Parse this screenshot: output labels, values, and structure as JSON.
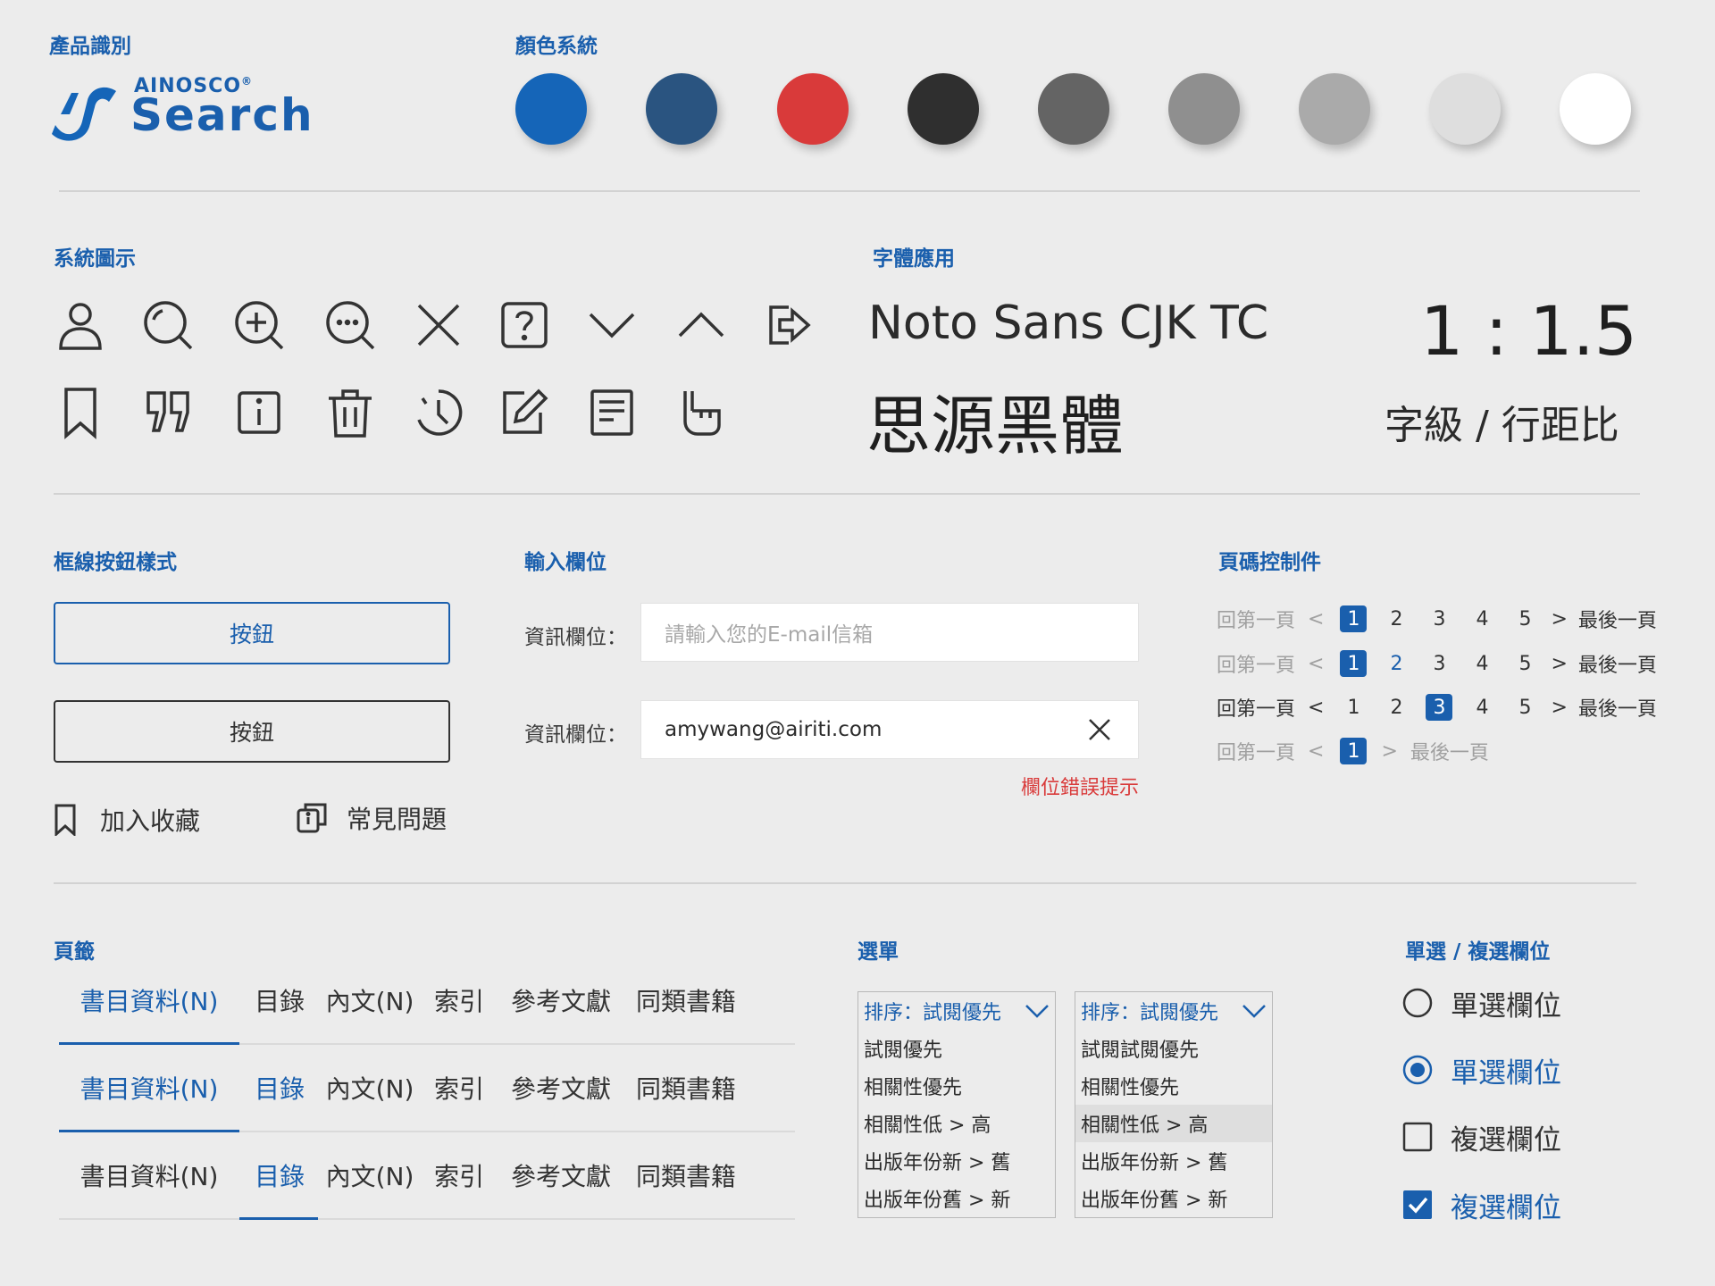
{
  "identity": {
    "title": "產品識別",
    "logo_small": "AINOSCO",
    "logo_reg": "®",
    "logo_main": "Search"
  },
  "colors": {
    "title": "顏色系統",
    "swatches": [
      "#1565b8",
      "#2a5480",
      "#d93a3a",
      "#2f2f2f",
      "#646464",
      "#8f8f8f",
      "#aaaaaa",
      "#dedede",
      "#ffffff"
    ]
  },
  "icons": {
    "title": "系統圖示",
    "row1": [
      "user-icon",
      "search-icon",
      "zoom-in-icon",
      "search-more-icon",
      "close-icon",
      "help-icon",
      "chevron-down-icon",
      "chevron-up-icon",
      "share-icon"
    ],
    "row2": [
      "bookmark-icon",
      "quote-icon",
      "info-icon",
      "trash-icon",
      "history-icon",
      "edit-icon",
      "document-icon",
      "hand-pointer-icon"
    ]
  },
  "fonts": {
    "title": "字體應用",
    "font_name": "Noto Sans CJK TC",
    "font_cjk": "思源黑體",
    "ratio": "1 : 1.5",
    "ratio_label": "字級 / 行距比"
  },
  "buttons": {
    "title": "框線按鈕樣式",
    "primary_label": "按鈕",
    "secondary_label": "按鈕",
    "bookmark_label": "加入收藏",
    "faq_label": "常見問題",
    "primary_color": "#1a5fad"
  },
  "inputs": {
    "title": "輸入欄位",
    "label1": "資訊欄位：",
    "placeholder": "請輸入您的E-mail信箱",
    "label2": "資訊欄位：",
    "value": "amywang@airiti.com",
    "error": "欄位錯誤提示",
    "error_color": "#d93a3a"
  },
  "pagination": {
    "title": "頁碼控制件",
    "first": "回第一頁",
    "prev": "<",
    "next": ">",
    "last": "最後一頁",
    "pages": [
      "1",
      "2",
      "3",
      "4",
      "5"
    ],
    "short_pages": [
      "1"
    ]
  },
  "tabs": {
    "title": "頁籤",
    "labels": [
      "書目資料(N)",
      "目錄",
      "內文(N)",
      "索引",
      "參考文獻",
      "同類書籍"
    ]
  },
  "select": {
    "title": "選單",
    "menu1": {
      "selected": "排序：試閱優先",
      "options": [
        "試閱優先",
        "相關性優先",
        "相關性低 > 高",
        "出版年份新 > 舊",
        "出版年份舊 > 新"
      ]
    },
    "menu2": {
      "selected": "排序：試閱優先",
      "options": [
        "試閱試閱優先",
        "相關性優先",
        "相關性低 > 高",
        "出版年份新 > 舊",
        "出版年份舊 > 新"
      ]
    }
  },
  "choices": {
    "title": "單選 / 複選欄位",
    "radio_unchecked": "單選欄位",
    "radio_checked": "單選欄位",
    "checkbox_unchecked": "複選欄位",
    "checkbox_checked": "複選欄位"
  }
}
